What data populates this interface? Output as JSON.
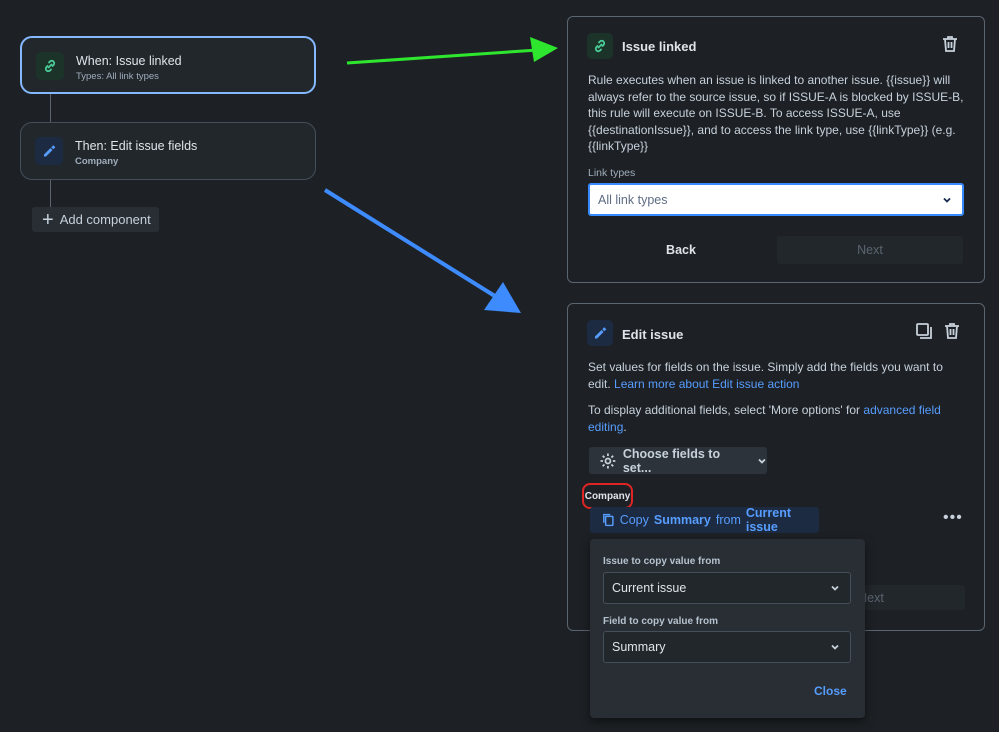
{
  "flow": {
    "trigger": {
      "title": "When: Issue linked",
      "subtitle": "Types: All link types"
    },
    "action": {
      "title": "Then: Edit issue fields",
      "subtitle": "Company"
    },
    "add_component_label": "Add component"
  },
  "issue_linked_panel": {
    "title": "Issue linked",
    "description": "Rule executes when an issue is linked to another issue. {{issue}} will always refer to the source issue, so if ISSUE-A is blocked by ISSUE-B, this rule will execute on ISSUE-B. To access ISSUE-A, use {{destinationIssue}}, and to access the link type, use {{linkType}} (e.g. {{linkType}}",
    "link_types_label": "Link types",
    "link_types_value": "All link types",
    "back_label": "Back",
    "next_label": "Next"
  },
  "edit_issue_panel": {
    "title": "Edit issue",
    "description_1": "Set values for fields on the issue. Simply add the fields you want to edit.",
    "learn_more_link": "Learn more about Edit issue action",
    "description_2": "To display additional fields, select 'More options' for",
    "advanced_link": "advanced field editing",
    "description_2_end": ".",
    "choose_fields_label": "Choose fields to set...",
    "field_label": "Company",
    "copy_prefix": "Copy",
    "copy_field": "Summary",
    "copy_mid": "from",
    "copy_source": "Current issue",
    "next_label": "Next"
  },
  "copy_popup": {
    "issue_label": "Issue to copy value from",
    "issue_value": "Current issue",
    "field_label": "Field to copy value from",
    "field_value": "Summary",
    "close_label": "Close"
  },
  "colors": {
    "arrow_green": "#2ee62e",
    "arrow_blue": "#3d8bfd",
    "highlight_red": "#e02424",
    "link_blue": "#579dff"
  }
}
